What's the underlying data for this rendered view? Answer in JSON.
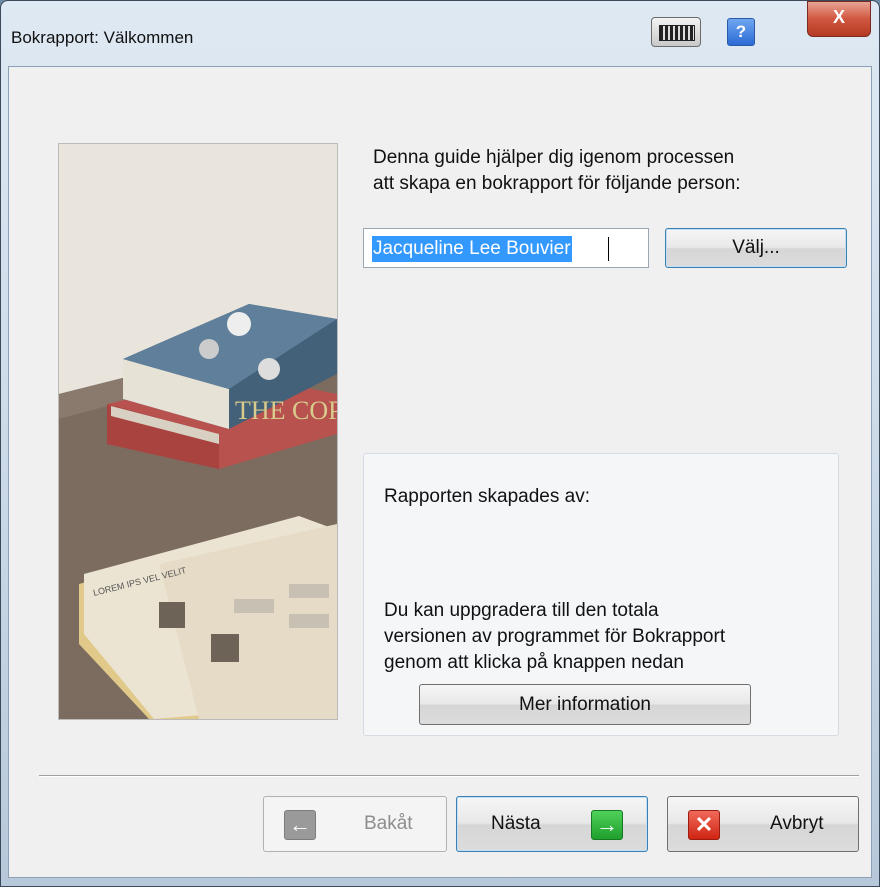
{
  "window": {
    "title": "Bokrapport: Välkommen",
    "help_glyph": "?",
    "close_glyph": "X",
    "accent_color": "#3399ff"
  },
  "wizard": {
    "intro_line1": "Denna guide hjälper dig igenom processen",
    "intro_line2": "att skapa en bokrapport för följande person:",
    "person_name": "Jacqueline Lee Bouvier",
    "choose_label": "Välj...",
    "picture_book_title": "THE COPP",
    "picture_paper_text": "LOREM IPS VEL VELIT"
  },
  "info_box": {
    "created_by_label": "Rapporten skapades av:",
    "upgrade_line1": "Du kan uppgradera till den totala",
    "upgrade_line2": "versionen av programmet för Bokrapport",
    "upgrade_line3": "genom att klicka på knappen nedan",
    "more_info_label": "Mer information"
  },
  "footer": {
    "back_label": "Bakåt",
    "next_label": "Nästa",
    "cancel_label": "Avbryt",
    "back_icon": "arrow-left-icon",
    "next_icon": "arrow-right-icon",
    "cancel_icon": "x-icon"
  }
}
